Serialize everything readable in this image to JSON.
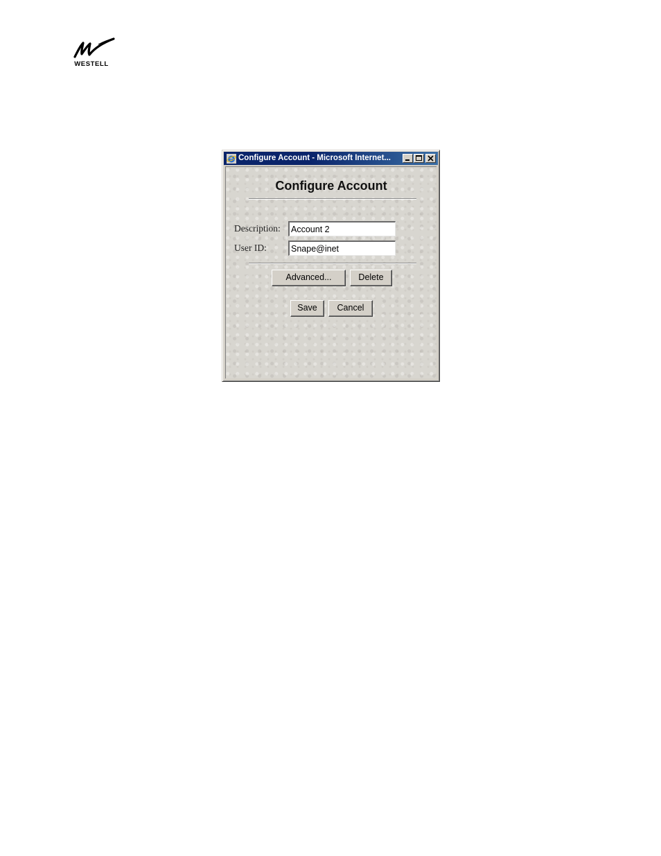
{
  "brand": {
    "logo_text": "WESTELL"
  },
  "window": {
    "title": "Configure Account - Microsoft Internet...",
    "icons": {
      "app": "ie-icon",
      "minimize": "minimize-icon",
      "maximize": "maximize-icon",
      "close": "close-icon"
    }
  },
  "form": {
    "heading": "Configure Account",
    "description_label": "Description:",
    "description_value": "Account 2",
    "userid_label": "User ID:",
    "userid_value": "Snape@inet"
  },
  "buttons": {
    "advanced": "Advanced...",
    "delete": "Delete",
    "save": "Save",
    "cancel": "Cancel"
  }
}
